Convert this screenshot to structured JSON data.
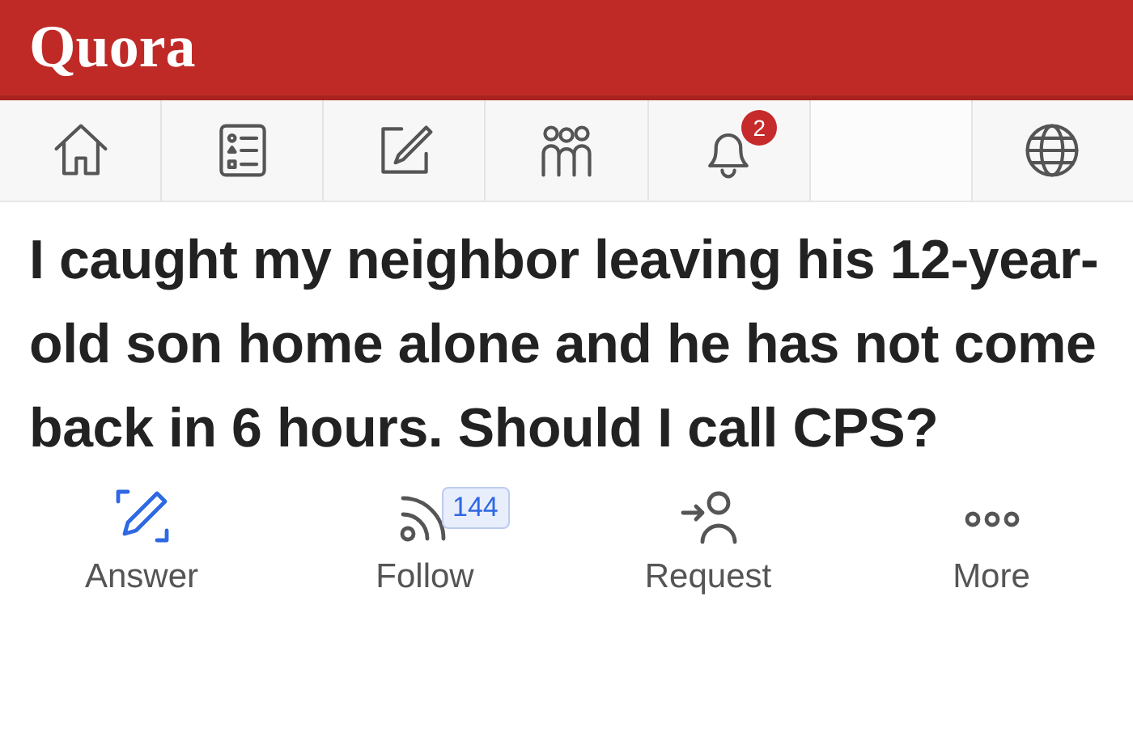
{
  "header": {
    "logo": "Quora"
  },
  "nav": [
    {
      "kind": "home"
    },
    {
      "kind": "list"
    },
    {
      "kind": "write"
    },
    {
      "kind": "people"
    },
    {
      "kind": "bell",
      "badge": "2"
    },
    {
      "kind": "blank"
    },
    {
      "kind": "globe"
    }
  ],
  "question": {
    "title": "I caught my neighbor leaving his 12-year-old son home alone and he has not come back in 6 hours. Should I call CPS?"
  },
  "actions": [
    {
      "kind": "answer",
      "label": "Answer",
      "highlighted": true
    },
    {
      "kind": "follow",
      "label": "Follow",
      "count": "144",
      "highlighted": false
    },
    {
      "kind": "request",
      "label": "Request",
      "highlighted": false
    },
    {
      "kind": "more",
      "label": "More",
      "highlighted": false
    }
  ]
}
